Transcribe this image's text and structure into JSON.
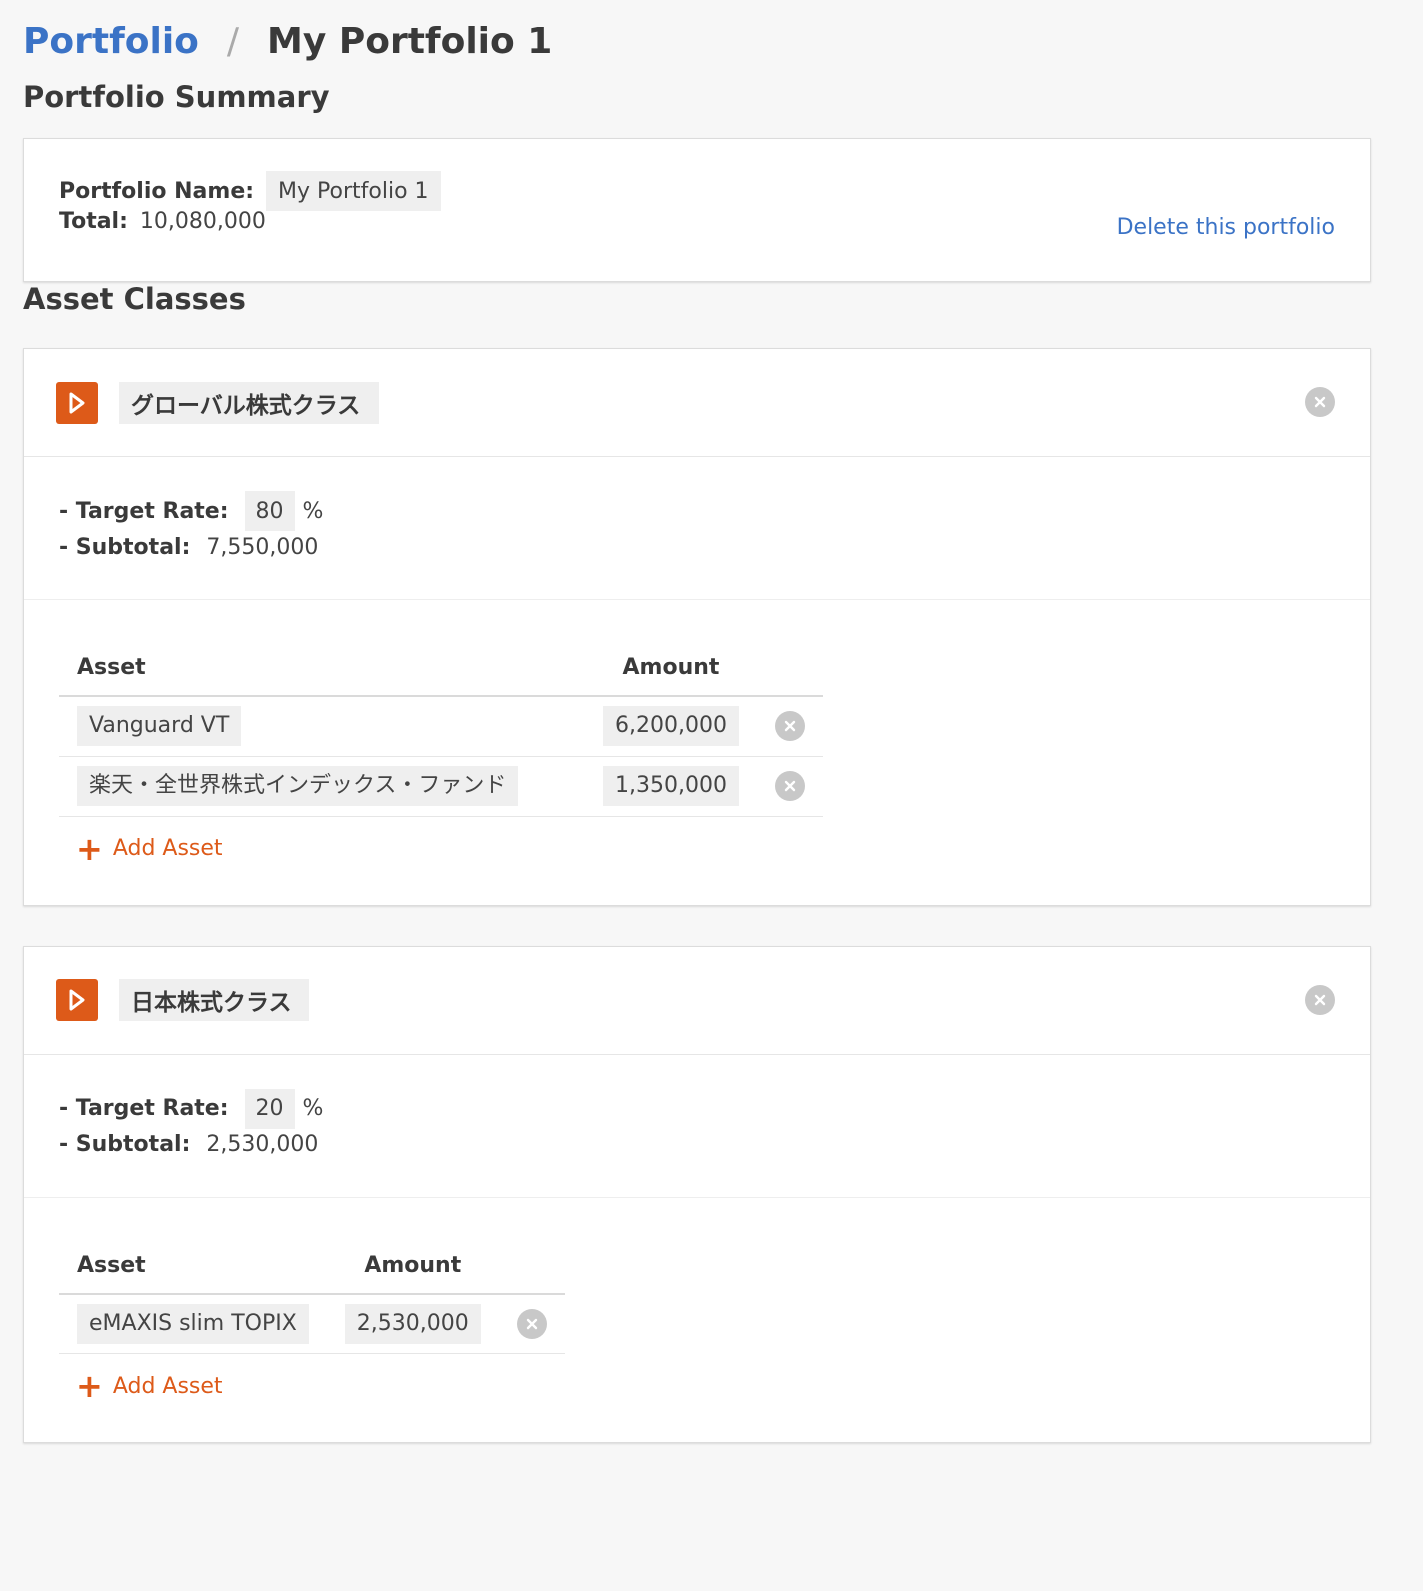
{
  "breadcrumb": {
    "root": "Portfolio",
    "separator": "/",
    "current": "My Portfolio 1"
  },
  "summary": {
    "heading": "Portfolio Summary",
    "name_label": "Portfolio Name:",
    "name_value": "My Portfolio 1",
    "total_label": "Total:",
    "total_value": "10,080,000",
    "delete_label": "Delete this portfolio"
  },
  "asset_classes_heading": "Asset Classes",
  "classes": [
    {
      "name": "グローバル株式クラス",
      "target_rate_label": "- Target Rate:",
      "target_rate": "80",
      "pct": "%",
      "subtotal_label": "- Subtotal:",
      "subtotal": "7,550,000",
      "col_asset": "Asset",
      "col_amount": "Amount",
      "assets": [
        {
          "name": "Vanguard VT",
          "amount": "6,200,000"
        },
        {
          "name": "楽天・全世界株式インデックス・ファンド",
          "amount": "1,350,000"
        }
      ],
      "add_asset_label": "Add Asset"
    },
    {
      "name": "日本株式クラス",
      "target_rate_label": "- Target Rate:",
      "target_rate": "20",
      "pct": "%",
      "subtotal_label": "- Subtotal:",
      "subtotal": "2,530,000",
      "col_asset": "Asset",
      "col_amount": "Amount",
      "assets": [
        {
          "name": "eMAXIS slim TOPIX",
          "amount": "2,530,000"
        }
      ],
      "add_asset_label": "Add Asset"
    }
  ],
  "colors": {
    "link": "#3b73c6",
    "accent": "#dd5a19",
    "input_bg": "#efefef",
    "page_bg": "#f7f7f7"
  },
  "icons": {
    "expand": "play-triangle-icon",
    "remove": "close-circle-icon",
    "add": "plus-icon"
  }
}
